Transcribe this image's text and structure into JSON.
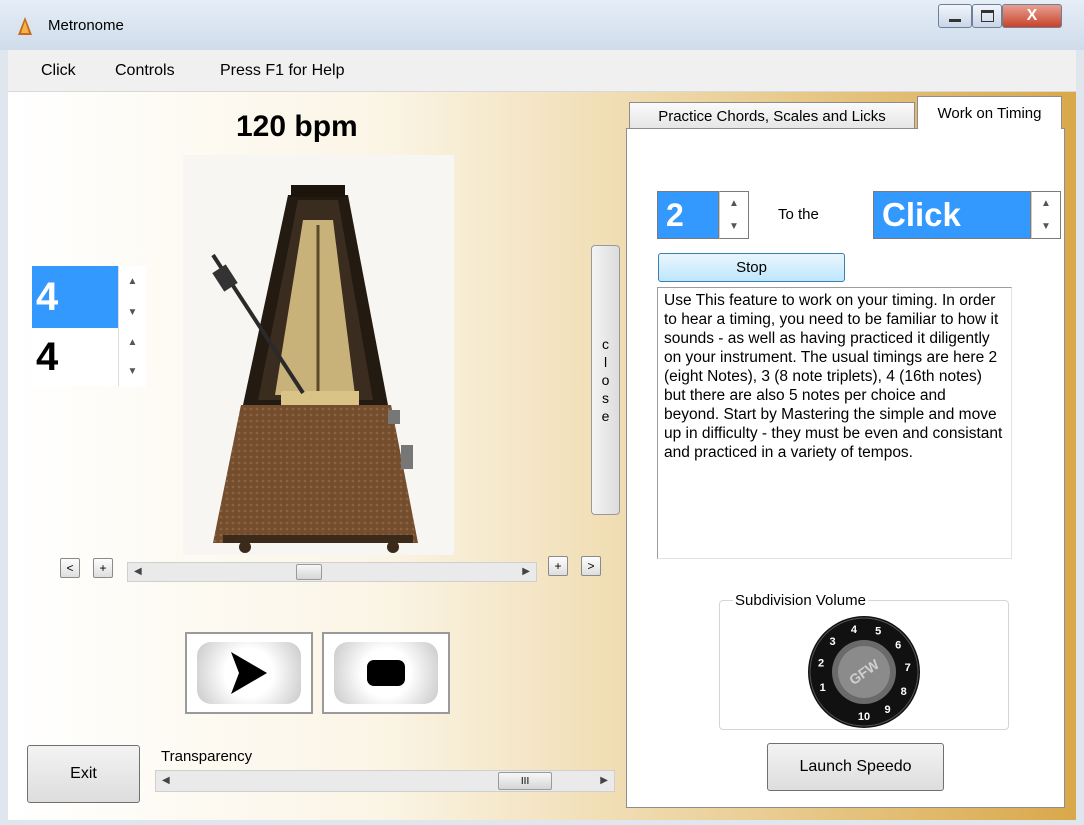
{
  "window": {
    "title": "Metronome",
    "close_glyph": "X"
  },
  "menu": {
    "items": [
      "Click",
      "Controls",
      "Press F1 for Help"
    ]
  },
  "tempo": {
    "label": "120 bpm"
  },
  "time_signature": {
    "top": "4",
    "bottom": "4"
  },
  "close_bar": {
    "letters": [
      "c",
      "l",
      "o",
      "s",
      "e"
    ]
  },
  "tempo_controls": {
    "dec_label": "<",
    "inc_label": "+",
    "inc2_label": "+",
    "next_label": ">",
    "slider_value": 0.43
  },
  "transport": {
    "play_icon": "play-icon",
    "stop_icon": "stop-icon"
  },
  "exit_label": "Exit",
  "transparency": {
    "label": "Transparency",
    "value": 0.88,
    "thumb_glyph": "III"
  },
  "tabs": [
    {
      "label": "Practice Chords, Scales and Licks",
      "active": false
    },
    {
      "label": "Work on Timing",
      "active": true
    }
  ],
  "timing": {
    "subdivision_value": "2",
    "to_the_label": "To the",
    "target_value": "Click",
    "stop_label": "Stop",
    "help_text": "Use This feature to work on your timing.  In order to hear a timing, you need to be familiar to how it sounds - as well as having practiced it diligently on your instrument. The usual timings are here 2 (eight Notes), 3 (8 note triplets), 4 (16th notes) but there are also 5 notes per choice and beyond. Start by Mastering the simple and move up in difficulty - they must be even and consistant and practiced in a variety of tempos."
  },
  "subdivision_volume": {
    "label": "Subdivision Volume",
    "knob_center": "GFW",
    "knob_numbers": [
      "1",
      "2",
      "3",
      "4",
      "5",
      "6",
      "7",
      "8",
      "9",
      "10"
    ]
  },
  "launch_speedo_label": "Launch Speedo",
  "colors": {
    "accent_blue": "#3399ff",
    "gold": "#d9a84a"
  }
}
